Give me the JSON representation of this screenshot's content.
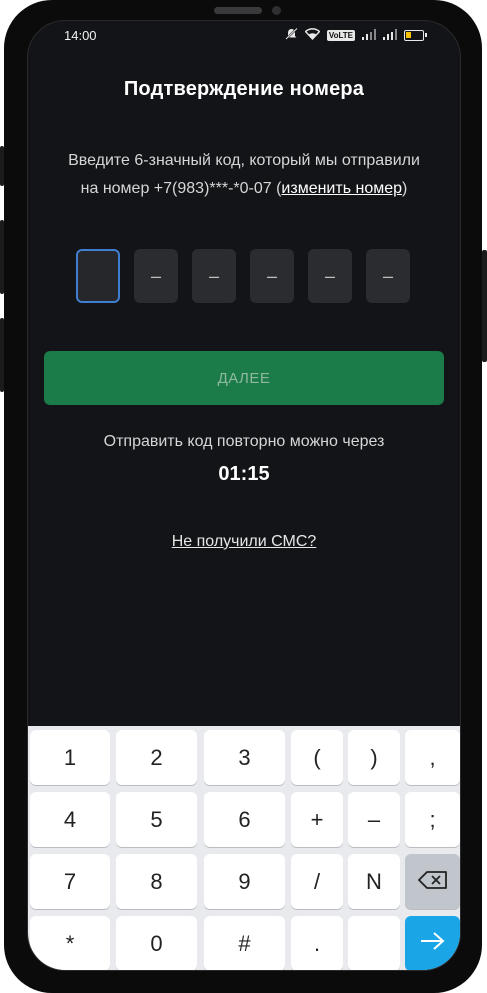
{
  "status_bar": {
    "time": "14:00",
    "volte_label": "VoLTE",
    "icons": [
      "mute-icon",
      "wifi-icon",
      "volte-icon",
      "signal-icon",
      "signal-icon",
      "battery-icon"
    ]
  },
  "screen": {
    "title": "Подтверждение номера",
    "description_line1": "Введите 6-значный код, который мы отправили",
    "description_line2_prefix": "на номер +7(983)***-*0-07 (",
    "change_number_link": "изменить номер",
    "description_line2_suffix": ")",
    "code_cells": [
      "",
      "–",
      "–",
      "–",
      "–",
      "–"
    ],
    "next_button": "ДАЛЕЕ",
    "resend_text": "Отправить код повторно можно через",
    "timer": "01:15",
    "no_sms_link": "Не получили СМС?"
  },
  "keyboard": {
    "rows": [
      [
        "1",
        "2",
        "3",
        "(",
        ")",
        ","
      ],
      [
        "4",
        "5",
        "6",
        "+",
        "–",
        ";"
      ],
      [
        "7",
        "8",
        "9",
        "/",
        "N",
        "⌫"
      ],
      [
        "*",
        "0",
        "#",
        ".",
        "",
        "→"
      ]
    ]
  },
  "colors": {
    "background": "#131417",
    "primary_button": "#1c7c49",
    "active_cell_border": "#3f7fd0",
    "keyboard_enter": "#1aa6e6"
  }
}
